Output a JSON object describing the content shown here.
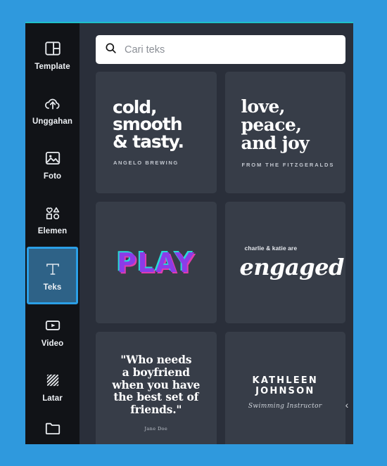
{
  "theme": {
    "canvas_blue": "#2f99dd",
    "sidebar_bg": "#111317",
    "panel_bg": "#2a2f3a",
    "card_bg": "#373d48",
    "accent_top_line": "#1fc0c8",
    "active_border": "#2b9fe6",
    "active_fill": "#2e6287"
  },
  "sidebar": {
    "items": [
      {
        "label": "Template",
        "icon": "template-icon",
        "active": false
      },
      {
        "label": "Unggahan",
        "icon": "upload-cloud-icon",
        "active": false
      },
      {
        "label": "Foto",
        "icon": "photo-icon",
        "active": false
      },
      {
        "label": "Elemen",
        "icon": "elements-icon",
        "active": false
      },
      {
        "label": "Teks",
        "icon": "text-t-icon",
        "active": true
      },
      {
        "label": "Video",
        "icon": "video-icon",
        "active": false
      },
      {
        "label": "Latar",
        "icon": "background-hatch-icon",
        "active": false
      },
      {
        "label": "",
        "icon": "folder-icon",
        "active": false
      }
    ]
  },
  "search": {
    "icon": "search-icon",
    "placeholder": "Cari teks",
    "value": ""
  },
  "cards": [
    {
      "id": "cold-smooth-tasty",
      "title": "cold,\nsmooth\n& tasty.",
      "title_line1": "cold,",
      "title_line2": "smooth",
      "title_line3": "& tasty.",
      "subtitle": "ANGELO BREWING"
    },
    {
      "id": "love-peace-joy",
      "title_line1": "love,",
      "title_line2": "peace,",
      "title_line3": "and joy",
      "subtitle": "FROM THE FITZGERALDS"
    },
    {
      "id": "play",
      "title": "PLAY",
      "color": "#8b3ce8",
      "shadow_cyan": "#28d8d8",
      "shadow_magenta": "#e03bb0"
    },
    {
      "id": "engaged",
      "subtitle": "charlie & katie are",
      "title": "engaged!"
    },
    {
      "id": "who-needs-a-boyfriend",
      "quote_line1": "\"Who needs",
      "quote_line2": "a boyfriend",
      "quote_line3": "when you have",
      "quote_line4": "the best set of",
      "quote_line5": "friends.\"",
      "author": "Jane Doe"
    },
    {
      "id": "kathleen-johnson",
      "name": "KATHLEEN JOHNSON",
      "role": "Swimming Instructor"
    }
  ],
  "collapse": {
    "glyph": "‹"
  }
}
